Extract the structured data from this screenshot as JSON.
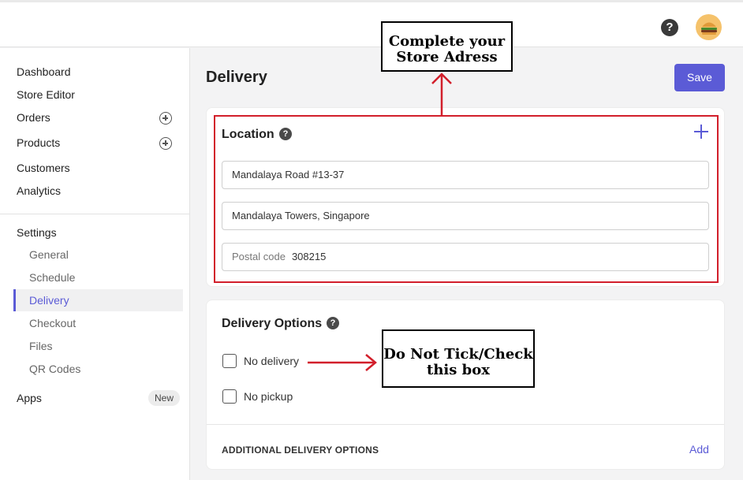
{
  "topbar": {
    "help_icon": "?"
  },
  "sidebar": {
    "items": [
      {
        "label": "Dashboard"
      },
      {
        "label": "Store Editor"
      },
      {
        "label": "Orders"
      },
      {
        "label": "Products"
      },
      {
        "label": "Customers"
      },
      {
        "label": "Analytics"
      }
    ],
    "settings_label": "Settings",
    "settings_items": [
      {
        "label": "General"
      },
      {
        "label": "Schedule"
      },
      {
        "label": "Delivery"
      },
      {
        "label": "Checkout"
      },
      {
        "label": "Files"
      },
      {
        "label": "QR Codes"
      }
    ],
    "apps_label": "Apps",
    "apps_badge": "New"
  },
  "page": {
    "title": "Delivery",
    "save_label": "Save"
  },
  "location": {
    "title": "Location",
    "help_icon": "?",
    "address_line1": "Mandalaya Road #13-37",
    "address_line2": "Mandalaya Towers, Singapore",
    "postal_placeholder": "Postal code",
    "postal_value": "308215"
  },
  "delivery_options": {
    "title": "Delivery Options",
    "help_icon": "?",
    "no_delivery_label": "No delivery",
    "no_pickup_label": "No pickup",
    "additional_label": "ADDITIONAL DELIVERY OPTIONS",
    "add_label": "Add"
  },
  "annotations": {
    "callout_top_line1": "Complete your",
    "callout_top_line2": "Store Adress",
    "callout_bottom_line1": "Do Not Tick/Check",
    "callout_bottom_line2": "this box"
  },
  "colors": {
    "accent": "#5b5bd6",
    "annotation_red": "#d21f2b"
  }
}
